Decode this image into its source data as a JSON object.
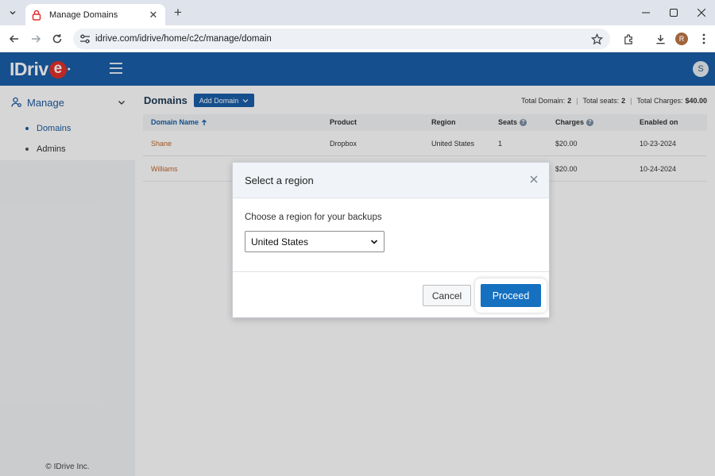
{
  "browser": {
    "tab_title": "Manage Domains",
    "url": "idrive.com/idrive/home/c2c/manage/domain",
    "profile_initial": "R"
  },
  "app": {
    "logo_text": "IDriv",
    "logo_e": "e",
    "user_initial": "S",
    "brand_color": "#1a5fa8"
  },
  "sidebar": {
    "section_label": "Manage",
    "items": [
      {
        "label": "Domains",
        "active": true
      },
      {
        "label": "Admins",
        "active": false
      }
    ],
    "copyright": "© IDrive Inc."
  },
  "main": {
    "title": "Domains",
    "add_domain_label": "Add Domain",
    "stats": [
      {
        "label": "Total Domain:",
        "value": "2"
      },
      {
        "label": "Total seats:",
        "value": "2"
      },
      {
        "label": "Total Charges:",
        "value": "$40.00"
      }
    ],
    "columns": [
      "Domain Name",
      "Product",
      "Region",
      "Seats",
      "Charges",
      "Enabled on"
    ],
    "rows": [
      {
        "domain": "Shane",
        "product": "Dropbox",
        "region": "United States",
        "seats": "1",
        "charges": "$20.00",
        "enabled": "10-23-2024"
      },
      {
        "domain": "Williams",
        "product": "",
        "region": "",
        "seats": "",
        "charges": "$20.00",
        "enabled": "10-24-2024"
      }
    ]
  },
  "modal": {
    "title": "Select a region",
    "label": "Choose a region for your backups",
    "selected_region": "United States",
    "cancel_label": "Cancel",
    "proceed_label": "Proceed"
  }
}
